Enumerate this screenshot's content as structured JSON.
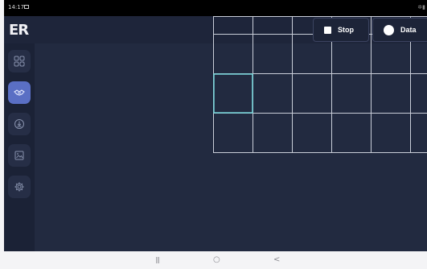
{
  "status_bar": {
    "time": "14:17"
  },
  "app": {
    "logo": "ER"
  },
  "sidebar": {
    "items": [
      {
        "icon": "grid-icon",
        "active": false
      },
      {
        "icon": "handshake-icon",
        "active": true
      },
      {
        "icon": "download-icon",
        "active": false
      },
      {
        "icon": "image-icon",
        "active": false
      },
      {
        "icon": "gear-icon",
        "active": false
      }
    ]
  },
  "controls": {
    "stop_label": "Stop",
    "data_label": "Data"
  },
  "grid": {
    "columns": 6,
    "rows": 4,
    "highlighted_cell": {
      "row": 3,
      "col": 1
    }
  },
  "colors": {
    "background": "#222a40",
    "sidebar": "#1b2236",
    "active_nav": "#5a6fc4",
    "grid_line": "#c9cdd8",
    "grid_highlight": "#6fd0d6"
  },
  "system_nav": {
    "recents": "|||",
    "home": "○",
    "back": "<"
  }
}
